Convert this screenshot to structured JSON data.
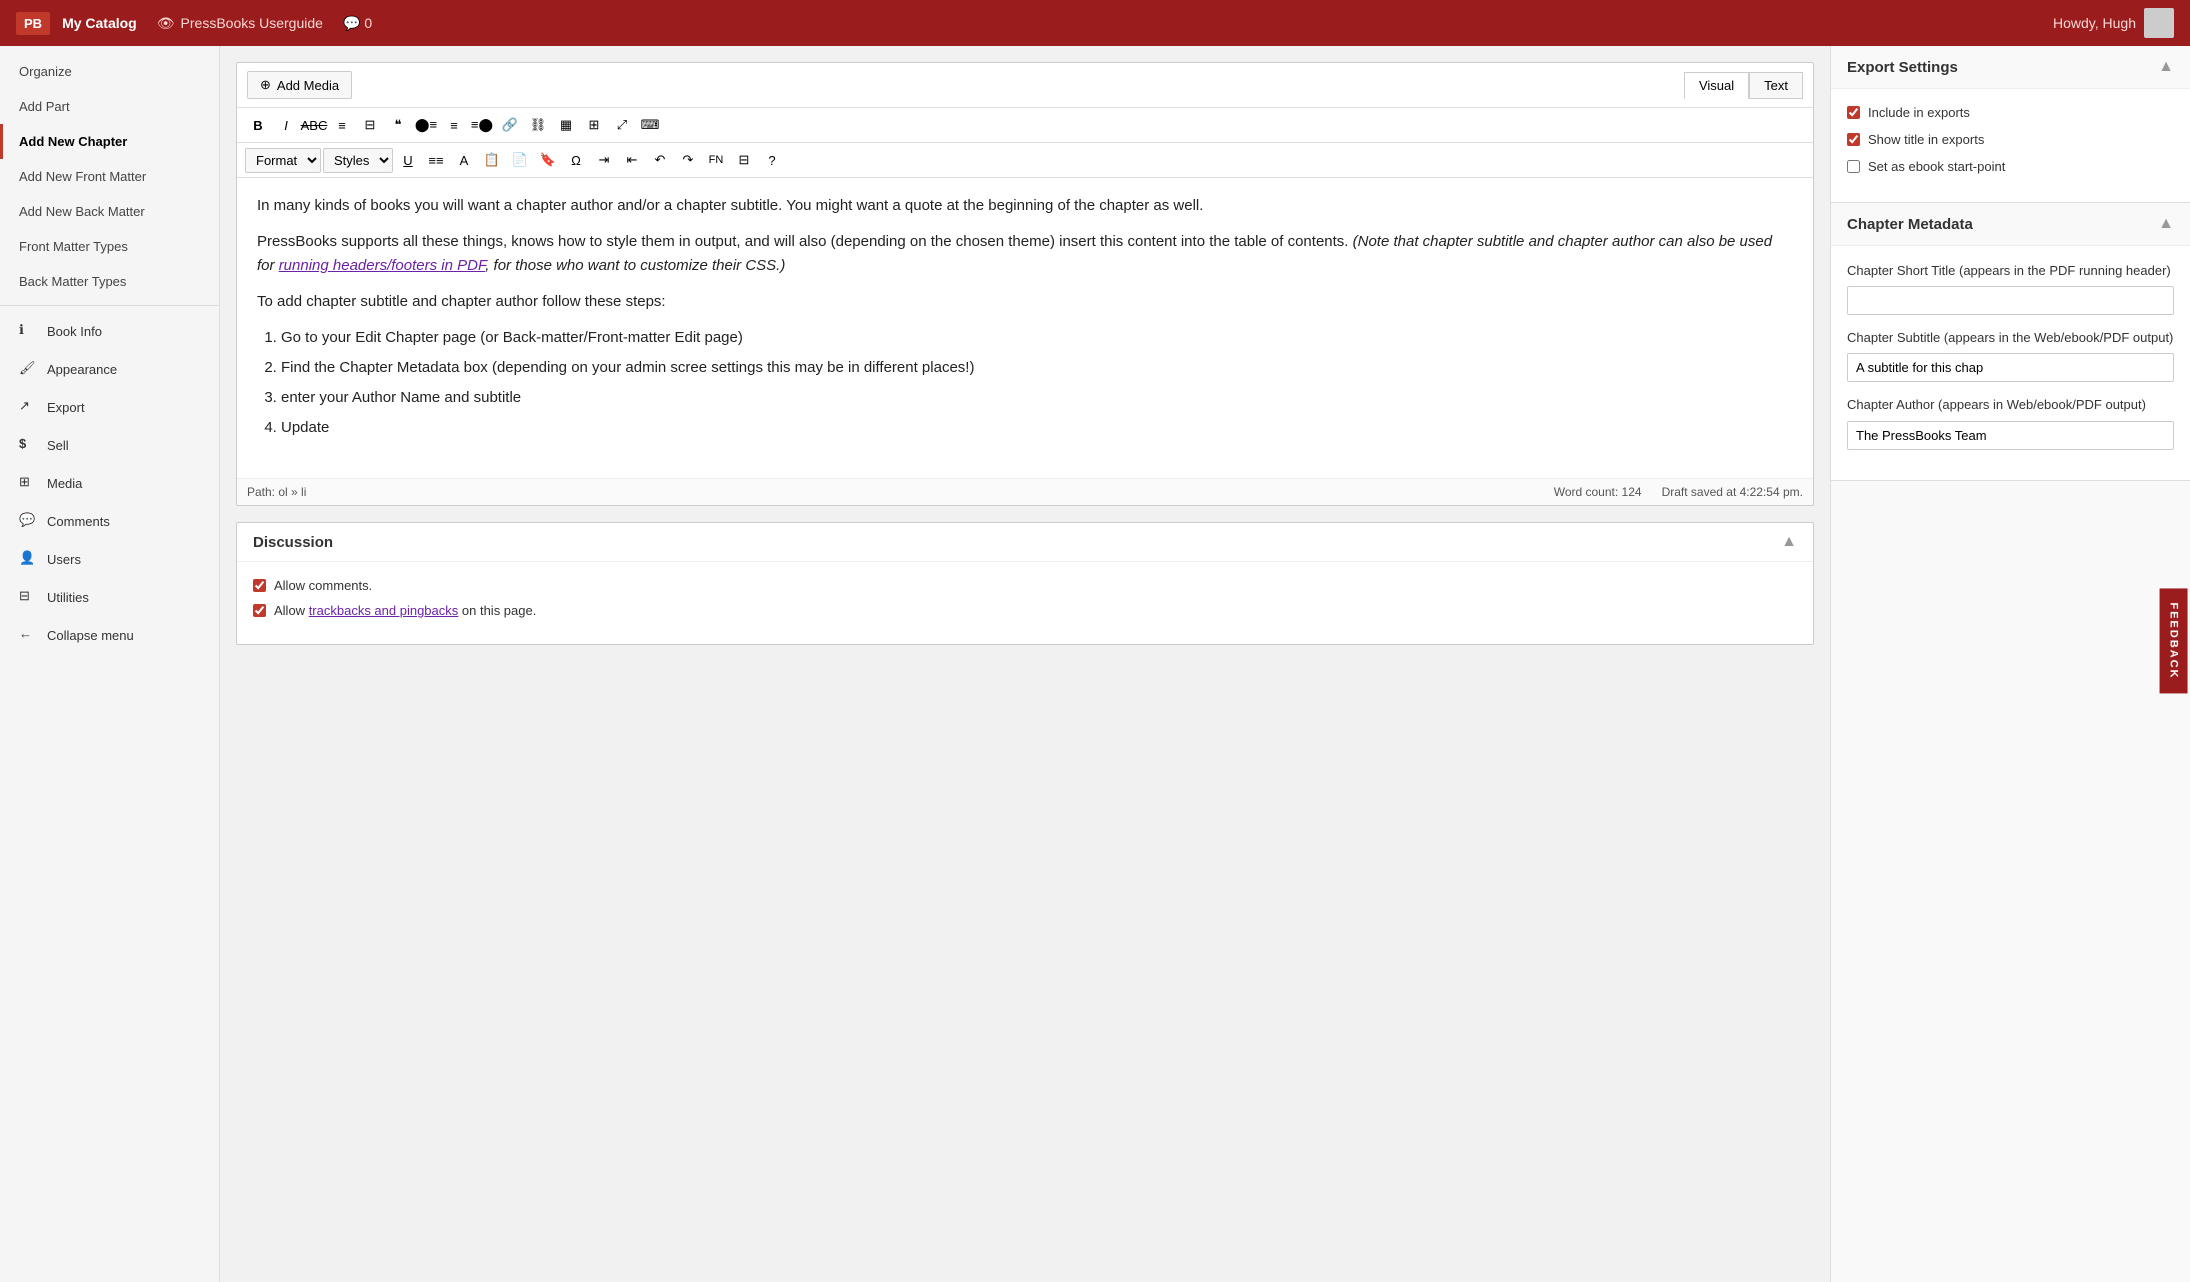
{
  "topbar": {
    "logo": "PB",
    "catalog": "My Catalog",
    "userguide": "PressBooks Userguide",
    "comments_count": "0",
    "howdy": "Howdy, Hugh"
  },
  "sidebar": {
    "items": [
      {
        "id": "organize",
        "label": "Organize",
        "icon": "",
        "bold": false
      },
      {
        "id": "add-part",
        "label": "Add Part",
        "icon": "",
        "bold": false
      },
      {
        "id": "add-new-chapter",
        "label": "Add New Chapter",
        "icon": "",
        "bold": true,
        "active": true
      },
      {
        "id": "add-new-front-matter",
        "label": "Add New Front Matter",
        "icon": "",
        "bold": false
      },
      {
        "id": "add-new-back-matter",
        "label": "Add New Back Matter",
        "icon": "",
        "bold": false
      },
      {
        "id": "front-matter-types",
        "label": "Front Matter Types",
        "icon": "",
        "bold": false
      },
      {
        "id": "back-matter-types",
        "label": "Back Matter Types",
        "icon": "",
        "bold": false
      }
    ],
    "menu_items": [
      {
        "id": "book-info",
        "label": "Book Info",
        "icon": "ℹ"
      },
      {
        "id": "appearance",
        "label": "Appearance",
        "icon": "🖌"
      },
      {
        "id": "export",
        "label": "Export",
        "icon": "↗"
      },
      {
        "id": "sell",
        "label": "Sell",
        "icon": "$"
      },
      {
        "id": "media",
        "label": "Media",
        "icon": "⊞"
      },
      {
        "id": "comments",
        "label": "Comments",
        "icon": "💬"
      },
      {
        "id": "users",
        "label": "Users",
        "icon": "👤"
      },
      {
        "id": "utilities",
        "label": "Utilities",
        "icon": "⊟"
      },
      {
        "id": "collapse",
        "label": "Collapse menu",
        "icon": "←"
      }
    ]
  },
  "toolbar": {
    "add_media_label": "Add Media",
    "visual_tab": "Visual",
    "text_tab": "Text",
    "format_label": "Format",
    "styles_label": "Styles"
  },
  "editor": {
    "content": [
      "In many kinds of books you will want a chapter author and/or a chapter subtitle. You might want a quote at the beginning of the chapter as well.",
      "PressBooks supports all these things, knows how to style them in output, and will also (depending on the chosen theme) insert this content into the table of contents.",
      "To add chapter subtitle and chapter author follow these steps:"
    ],
    "italic_note": "(Note that chapter subtitle and chapter author can also be used for running headers/footers in PDF, for those who want to customize their CSS.)",
    "link_text": "running headers/footers in PDF",
    "steps": [
      "Go to your Edit Chapter page (or Back-matter/Front-matter Edit page)",
      "Find the Chapter Metadata box (depending on your admin scree settings this may be in different places!)",
      "enter your Author Name and subtitle",
      "Update"
    ],
    "path": "Path: ol » li",
    "word_count_label": "Word count:",
    "word_count": "124",
    "draft_saved": "Draft saved at 4:22:54 pm."
  },
  "discussion": {
    "title": "Discussion",
    "allow_comments": "Allow comments.",
    "allow_trackbacks_prefix": "Allow ",
    "trackbacks_link": "trackbacks and pingbacks",
    "allow_trackbacks_suffix": " on this page."
  },
  "export_settings": {
    "title": "Export Settings",
    "include_in_exports": "Include in exports",
    "show_title_in_exports": "Show title in exports",
    "set_as_ebook_start_point": "Set as ebook start-point",
    "include_checked": true,
    "show_title_checked": true,
    "ebook_start_checked": false
  },
  "chapter_metadata": {
    "title": "Chapter Metadata",
    "short_title_label": "Chapter Short Title (appears in the PDF running header)",
    "short_title_value": "",
    "subtitle_label": "Chapter Subtitle (appears in the Web/ebook/PDF output)",
    "subtitle_value": "A subtitle for this chap",
    "author_label": "Chapter Author (appears in Web/ebook/PDF output)",
    "author_value": "The PressBooks Team"
  },
  "feedback_tab": "FEEDBACK"
}
